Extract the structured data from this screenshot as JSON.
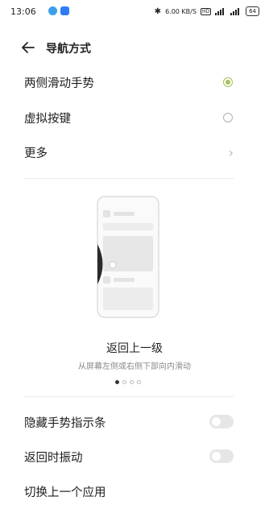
{
  "status_bar": {
    "time": "13:06",
    "net_speed": "6.00 KB/S",
    "battery": "64"
  },
  "header": {
    "title": "导航方式"
  },
  "options": [
    {
      "label": "两侧滑动手势",
      "selected": true
    },
    {
      "label": "虚拟按键",
      "selected": false
    }
  ],
  "more": {
    "label": "更多"
  },
  "illustration": {
    "title": "返回上一级",
    "subtitle": "从屏幕左侧或右侧下部向内滑动",
    "page_count": 4,
    "current_page": 1
  },
  "toggles": [
    {
      "label": "隐藏手势指示条",
      "on": false
    },
    {
      "label": "返回时振动",
      "on": false
    }
  ],
  "last_item": {
    "label": "切换上一个应用"
  },
  "colors": {
    "accent": "#a5c25a",
    "divider": "#ececec"
  }
}
